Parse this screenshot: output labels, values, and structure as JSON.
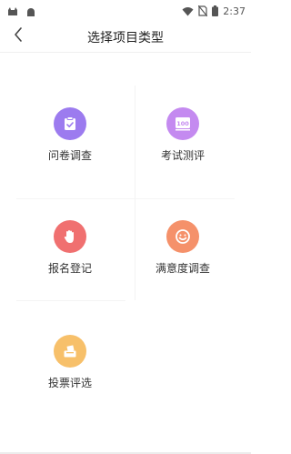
{
  "status_bar": {
    "time": "2:37",
    "icons": [
      "cat-icon",
      "android-icon",
      "wifi-icon",
      "no-sim-icon",
      "battery-icon"
    ]
  },
  "header": {
    "title": "选择项目类型",
    "back_icon": "chevron-left-icon"
  },
  "project_types": [
    {
      "label": "问卷调查",
      "icon": "clipboard-check-icon",
      "color": "#9C7BEF"
    },
    {
      "label": "考试测评",
      "icon": "score-100-icon",
      "color": "#C48AF0"
    },
    {
      "label": "报名登记",
      "icon": "raised-hand-icon",
      "color": "#F07070"
    },
    {
      "label": "满意度调查",
      "icon": "smiley-icon",
      "color": "#F5916A"
    },
    {
      "label": "投票评选",
      "icon": "ballot-box-icon",
      "color": "#F7C06A"
    }
  ]
}
